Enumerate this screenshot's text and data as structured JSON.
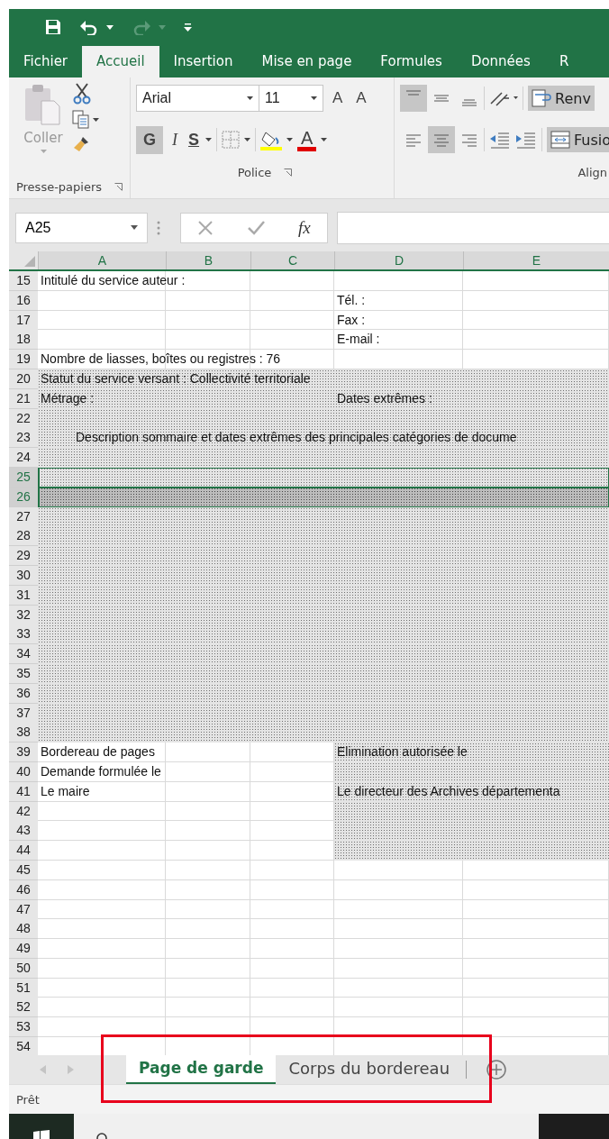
{
  "tabs": [
    {
      "label": "Fichier",
      "selected": false
    },
    {
      "label": "Accueil",
      "selected": true
    },
    {
      "label": "Insertion",
      "selected": false
    },
    {
      "label": "Mise en page",
      "selected": false
    },
    {
      "label": "Formules",
      "selected": false
    },
    {
      "label": "Données",
      "selected": false
    },
    {
      "label": "R",
      "selected": false
    }
  ],
  "ribbon": {
    "clipboard": {
      "paste_label": "Coller",
      "group_label": "Presse-papiers"
    },
    "font": {
      "font_name": "Arial",
      "font_size": "11",
      "grow_font": "A",
      "shrink_font": "A",
      "bold_label": "G",
      "italic_label": "I",
      "underline_label": "S",
      "font_color": "A",
      "group_label": "Police"
    },
    "alignment": {
      "wrap_label": "Renv",
      "merge_label": "Fusio",
      "group_label": "Align"
    }
  },
  "formula_bar": {
    "name_box": "A25",
    "function_label": "fx"
  },
  "columns": [
    "A",
    "B",
    "C",
    "D",
    "E"
  ],
  "rows": [
    {
      "number": "15",
      "kind": "none",
      "selected": false,
      "a": "Intitulé du service auteur :"
    },
    {
      "number": "16",
      "kind": "none",
      "selected": false,
      "d": "Tél. :"
    },
    {
      "number": "17",
      "kind": "none",
      "selected": false,
      "d": "Fax :"
    },
    {
      "number": "18",
      "kind": "none",
      "selected": false,
      "d": "E-mail :"
    },
    {
      "number": "19",
      "kind": "none",
      "selected": false,
      "a": "Nombre de liasses, boîtes ou registres : 76"
    },
    {
      "number": "20",
      "kind": "full",
      "selected": false,
      "a": "Statut du service versant : Collectivité territoriale"
    },
    {
      "number": "21",
      "kind": "full",
      "selected": false,
      "a": "Métrage :",
      "d": "Dates extrêmes :"
    },
    {
      "number": "22",
      "kind": "full",
      "selected": false
    },
    {
      "number": "23",
      "kind": "full",
      "selected": false,
      "a": "Description sommaire et dates extrêmes des principales catégories de docume"
    },
    {
      "number": "24",
      "kind": "full",
      "selected": false
    },
    {
      "number": "25",
      "kind": "full",
      "selected": true
    },
    {
      "number": "26",
      "kind": "dark",
      "selected": true
    },
    {
      "number": "27",
      "kind": "full",
      "selected": false
    },
    {
      "number": "28",
      "kind": "full",
      "selected": false
    },
    {
      "number": "29",
      "kind": "full",
      "selected": false
    },
    {
      "number": "30",
      "kind": "full",
      "selected": false
    },
    {
      "number": "31",
      "kind": "full",
      "selected": false
    },
    {
      "number": "32",
      "kind": "full",
      "selected": false
    },
    {
      "number": "33",
      "kind": "full",
      "selected": false
    },
    {
      "number": "34",
      "kind": "full",
      "selected": false
    },
    {
      "number": "35",
      "kind": "full",
      "selected": false
    },
    {
      "number": "36",
      "kind": "full",
      "selected": false
    },
    {
      "number": "37",
      "kind": "full",
      "selected": false
    },
    {
      "number": "38",
      "kind": "full",
      "selected": false
    },
    {
      "number": "39",
      "kind": "right",
      "selected": false,
      "a": "Bordereau de  pages",
      "d": "Elimination autorisée le"
    },
    {
      "number": "40",
      "kind": "right",
      "selected": false,
      "a": "Demande formulée le"
    },
    {
      "number": "41",
      "kind": "right",
      "selected": false,
      "a": "Le maire",
      "d": "Le directeur des Archives départementa"
    },
    {
      "number": "42",
      "kind": "right",
      "selected": false
    },
    {
      "number": "43",
      "kind": "right",
      "selected": false
    },
    {
      "number": "44",
      "kind": "right",
      "selected": false
    },
    {
      "number": "45",
      "kind": "none",
      "selected": false
    },
    {
      "number": "46",
      "kind": "none",
      "selected": false
    },
    {
      "number": "47",
      "kind": "none",
      "selected": false
    },
    {
      "number": "48",
      "kind": "none",
      "selected": false
    },
    {
      "number": "49",
      "kind": "none",
      "selected": false
    },
    {
      "number": "50",
      "kind": "none",
      "selected": false
    },
    {
      "number": "51",
      "kind": "none",
      "selected": false
    },
    {
      "number": "52",
      "kind": "none",
      "selected": false
    },
    {
      "number": "53",
      "kind": "none",
      "selected": false
    },
    {
      "number": "54",
      "kind": "none",
      "selected": false
    }
  ],
  "sheet_tabs": [
    {
      "label": "Page de garde",
      "selected": true
    },
    {
      "label": "Corps du bordereau",
      "selected": false
    }
  ],
  "status": "Prêt"
}
